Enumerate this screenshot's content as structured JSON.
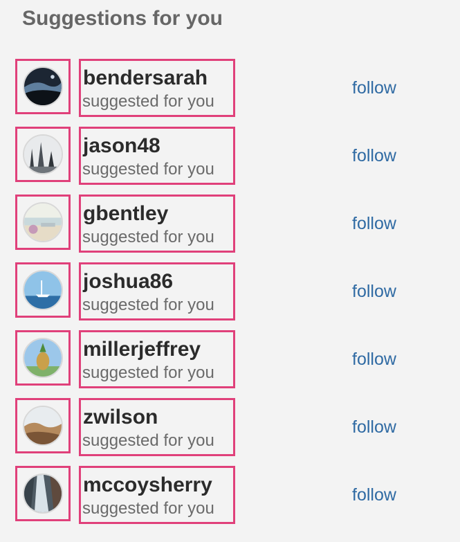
{
  "header": {
    "title": "Suggestions for you"
  },
  "follow_color": "#2f6aa3",
  "highlight_color": "#e0407a",
  "suggestions": [
    {
      "username": "bendersarah",
      "subtitle": "suggested for you",
      "action": "follow",
      "avatar": "night-sky-avatar"
    },
    {
      "username": "jason48",
      "subtitle": "suggested for you",
      "action": "follow",
      "avatar": "forest-avatar"
    },
    {
      "username": "gbentley",
      "subtitle": "suggested for you",
      "action": "follow",
      "avatar": "beach-avatar"
    },
    {
      "username": "joshua86",
      "subtitle": "suggested for you",
      "action": "follow",
      "avatar": "sailboat-avatar"
    },
    {
      "username": "millerjeffrey",
      "subtitle": "suggested for you",
      "action": "follow",
      "avatar": "pineapple-avatar"
    },
    {
      "username": "zwilson",
      "subtitle": "suggested for you",
      "action": "follow",
      "avatar": "desert-avatar"
    },
    {
      "username": "mccoysherry",
      "subtitle": "suggested for you",
      "action": "follow",
      "avatar": "waterfall-avatar"
    }
  ]
}
